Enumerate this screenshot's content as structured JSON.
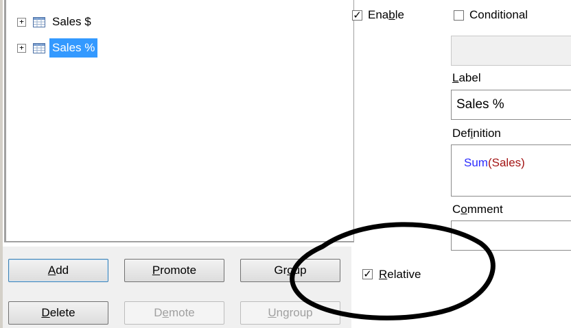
{
  "tree": {
    "items": [
      {
        "label": "Sales $",
        "expander": "+",
        "selected": false
      },
      {
        "label": "Sales %",
        "expander": "+",
        "selected": true
      }
    ]
  },
  "buttons": {
    "add": {
      "prefix": "",
      "underline": "A",
      "suffix": "dd"
    },
    "promote": {
      "prefix": "",
      "underline": "P",
      "suffix": "romote"
    },
    "group": {
      "prefix": "Gr",
      "underline": "o",
      "suffix": "up"
    },
    "delete": {
      "prefix": "",
      "underline": "D",
      "suffix": "elete"
    },
    "demote": {
      "prefix": "D",
      "underline": "e",
      "suffix": "mote"
    },
    "ungroup": {
      "prefix": "",
      "underline": "U",
      "suffix": "ngroup"
    }
  },
  "relative": {
    "prefix": "",
    "underline": "R",
    "suffix": "elative",
    "checked": true,
    "mark": "✓"
  },
  "enable": {
    "prefix": "Ena",
    "underline": "b",
    "suffix": "le",
    "checked": true,
    "mark": "✓"
  },
  "conditional": {
    "label": "Conditional",
    "checked": false
  },
  "label_field": {
    "caption_underline": "L",
    "caption_rest": "abel",
    "value": "Sales %"
  },
  "definition": {
    "caption_prefix": "Def",
    "caption_underline": "i",
    "caption_suffix": "nition",
    "function_name": "Sum",
    "open_paren": "(",
    "argument": "Sales",
    "close_paren": ")"
  },
  "comment": {
    "caption_prefix": "C",
    "caption_underline": "o",
    "caption_suffix": "mment",
    "value": ""
  },
  "colors": {
    "selection": "#3399ff",
    "function": "#2b2bff",
    "argument": "#a31515"
  }
}
